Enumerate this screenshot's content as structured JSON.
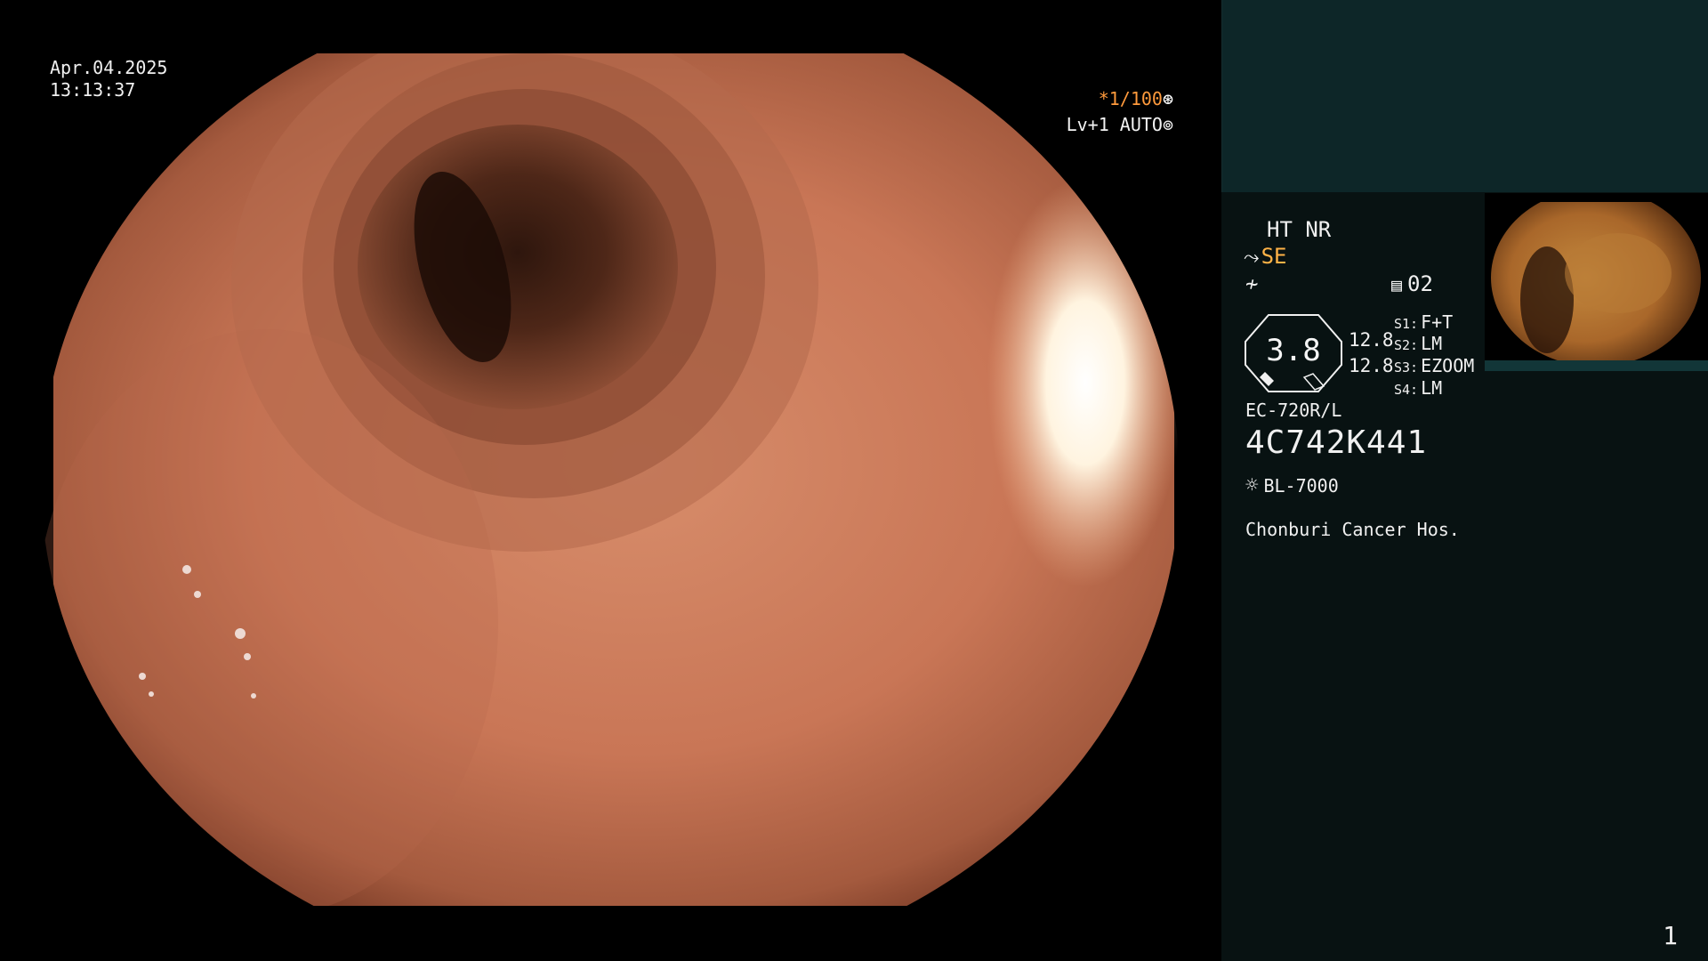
{
  "overlay": {
    "date": "Apr.04.2025",
    "time": "13:13:37",
    "shutter": "*1/100",
    "shutter_icon": "shutter-icon",
    "iris": "Lv+1 AUTO",
    "iris_icon": "iris-icon"
  },
  "panel": {
    "enhancement": "HT NR",
    "structure_mode": "SE",
    "structure_icon": "structure-enhance-icon",
    "freeze_icon": "freeze-icon",
    "memory_icon": "memory-icon",
    "memory": "02",
    "gauge_value": "3.8",
    "gauge_readout_1": "12.8",
    "gauge_readout_2": "12.8",
    "switches": [
      {
        "key": "S1:",
        "value": "F+T"
      },
      {
        "key": "S2:",
        "value": "LM"
      },
      {
        "key": "S3:",
        "value": "EZOOM"
      },
      {
        "key": "S4:",
        "value": "LM"
      }
    ],
    "scope_model": "EC-720R/L",
    "scope_serial": "4C742K441",
    "light_icon": "light-source-icon",
    "light_source": "BL-7000",
    "hospital": "Chonburi Cancer Hos."
  },
  "page_number": "1",
  "colors": {
    "accent_orange": "#ffb347",
    "panel_bg": "#081212",
    "panel_top": "#0d2628"
  }
}
